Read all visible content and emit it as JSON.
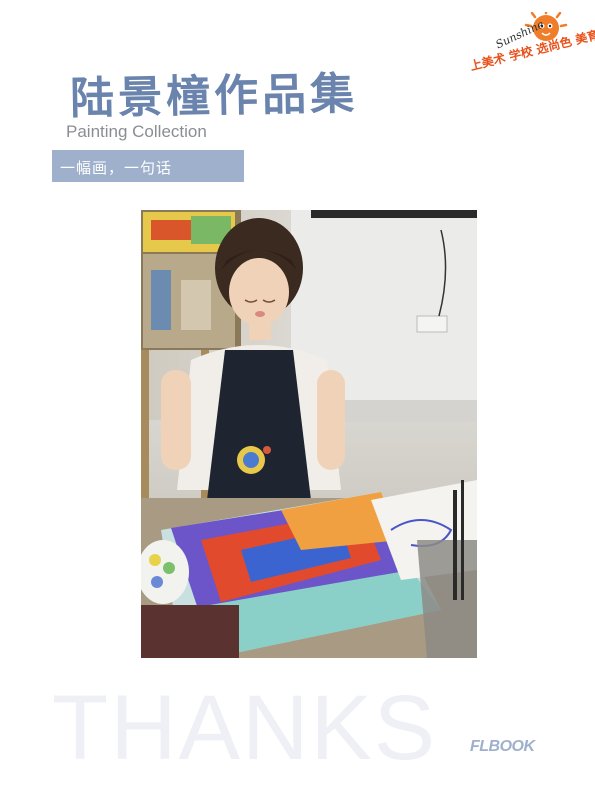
{
  "header": {
    "title": "陆景橦作品集",
    "subtitle": "Painting Collection",
    "tagline": "一幅画，一句话"
  },
  "logo": {
    "text": "上美术 学校 选尚色 美育！",
    "script": "Sunshine"
  },
  "photo": {
    "icon": "photo-of-child-painting"
  },
  "footer": {
    "thanks": "THANKS",
    "brand": "FLBOOK"
  },
  "colors": {
    "title": "#6a84ad",
    "tagline_bg": "#9fb0cc",
    "logo_orange": "#e8521c"
  }
}
